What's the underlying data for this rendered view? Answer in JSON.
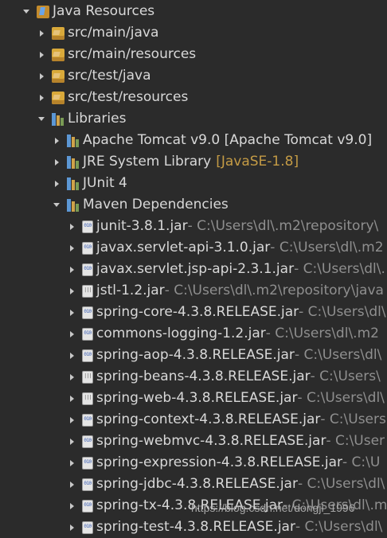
{
  "tree": {
    "java_resources": "Java Resources",
    "src_main_java": "src/main/java",
    "src_main_resources": "src/main/resources",
    "src_test_java": "src/test/java",
    "src_test_resources": "src/test/resources",
    "libraries": "Libraries",
    "tomcat": "Apache Tomcat v9.0 [Apache Tomcat v9.0]",
    "jre": "JRE System Library",
    "jre_tag": "[JavaSE-1.8]",
    "junit4": "JUnit 4",
    "maven": "Maven Dependencies",
    "jars": [
      {
        "name": "junit-3.8.1.jar",
        "path": " - C:\\Users\\dl\\.m2\\repository\\"
      },
      {
        "name": "javax.servlet-api-3.1.0.jar",
        "path": " - C:\\Users\\dl\\.m2"
      },
      {
        "name": "javax.servlet.jsp-api-2.3.1.jar",
        "path": " - C:\\Users\\dl\\."
      },
      {
        "name": "jstl-1.2.jar",
        "path": " - C:\\Users\\dl\\.m2\\repository\\java"
      },
      {
        "name": "spring-core-4.3.8.RELEASE.jar",
        "path": " - C:\\Users\\dl\\"
      },
      {
        "name": "commons-logging-1.2.jar",
        "path": " - C:\\Users\\dl\\.m2"
      },
      {
        "name": "spring-aop-4.3.8.RELEASE.jar",
        "path": " - C:\\Users\\dl\\"
      },
      {
        "name": "spring-beans-4.3.8.RELEASE.jar",
        "path": " - C:\\Users\\"
      },
      {
        "name": "spring-web-4.3.8.RELEASE.jar",
        "path": " - C:\\Users\\dl\\"
      },
      {
        "name": "spring-context-4.3.8.RELEASE.jar",
        "path": " - C:\\Users"
      },
      {
        "name": "spring-webmvc-4.3.8.RELEASE.jar",
        "path": " - C:\\User"
      },
      {
        "name": "spring-expression-4.3.8.RELEASE.jar",
        "path": " - C:\\U"
      },
      {
        "name": "spring-jdbc-4.3.8.RELEASE.jar",
        "path": " - C:\\Users\\dl\\"
      },
      {
        "name": "spring-tx-4.3.8.RELEASE.jar",
        "path": " - C:\\Users\\dl\\.m"
      },
      {
        "name": "spring-test-4.3.8.RELEASE.jar",
        "path": " - C:\\Users\\dl\\"
      }
    ]
  },
  "watermark": "https://blog.csdn.net/dongji_1996",
  "colors": {
    "background": "#2b2b2b",
    "text": "#d8d8d8",
    "decoration": "#8f8f8f",
    "jre_tag": "#c49b45"
  }
}
